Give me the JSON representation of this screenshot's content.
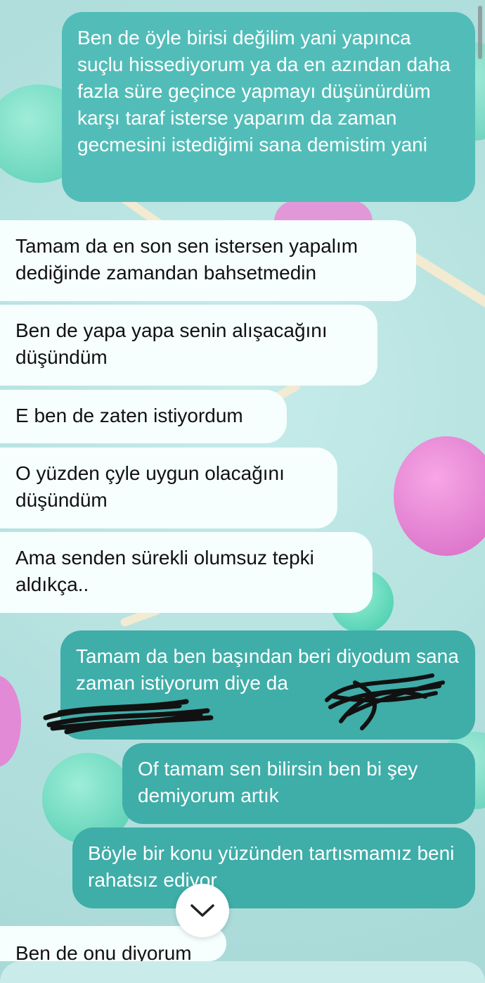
{
  "thread": {
    "messages": [
      {
        "side": "out",
        "text": "Ben de öyle birisi değilim yani yapınca suçlu hissediyorum ya da en azından daha fazla süre geçince yapmayı düşünürdüm karşı taraf isterse yaparım da zaman gecmesini istediğimi sana demistim yani"
      },
      {
        "side": "in",
        "text": "Tamam da en son sen istersen yapalım dediğinde zamandan bahsetmedin"
      },
      {
        "side": "in",
        "text": "Ben de yapa yapa senin alışacağını düşündüm"
      },
      {
        "side": "in",
        "text": "E ben de zaten istiyordum"
      },
      {
        "side": "in",
        "text": "O yüzden çyle uygun olacağını düşündüm"
      },
      {
        "side": "in",
        "text": "Ama senden sürekli olumsuz tepki aldıkça.."
      },
      {
        "side": "out",
        "text": "Tamam da ben başından beri diyodum sana zaman istiyorum diye da"
      },
      {
        "side": "out",
        "text": "Of tamam sen bilirsin ben bi şey demiyorum artık"
      },
      {
        "side": "out",
        "text": "Böyle bir konu yüzünden tartısmamız beni rahatsız ediyor"
      },
      {
        "side": "in",
        "text": "Ben de onu diyorum"
      }
    ]
  },
  "scroll_down": {
    "icon": "chevron-down-icon"
  },
  "colors": {
    "incoming_bubble": "#f6fffe",
    "outgoing_bubble": "#52bdb8",
    "background": "#b6e2e0"
  }
}
